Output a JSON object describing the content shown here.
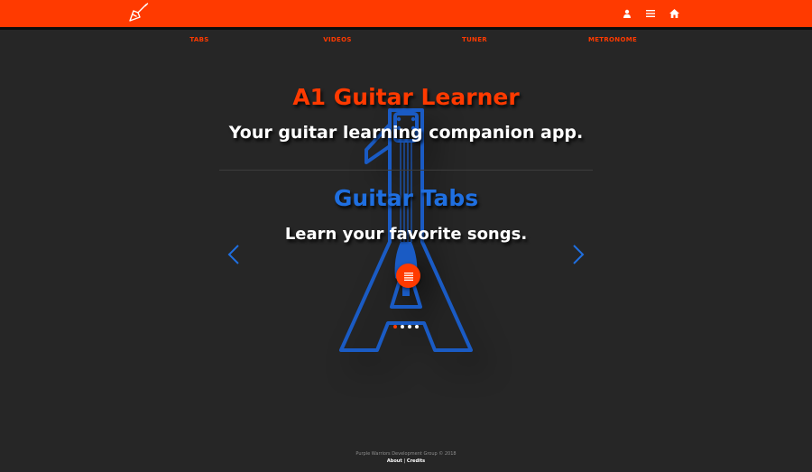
{
  "header": {
    "logo_icon": "guitar-logo-icon",
    "icons": [
      "user-icon",
      "menu-icon",
      "home-icon"
    ],
    "background": "#ff3a00"
  },
  "nav": {
    "items": [
      {
        "label": "TABS"
      },
      {
        "label": "VIDEOS"
      },
      {
        "label": "TUNER"
      },
      {
        "label": "METRONOME"
      }
    ]
  },
  "hero": {
    "title": "A1 Guitar Learner",
    "subtitle": "Your guitar learning companion app."
  },
  "carousel": {
    "slide_title": "Guitar Tabs",
    "slide_subtitle": "Learn your favorite songs.",
    "prev_icon": "chevron-left-icon",
    "next_icon": "chevron-right-icon",
    "action_icon": "list-icon",
    "slide_count": 4,
    "active_index": 0
  },
  "footer": {
    "copyright": "Purple Warriors Development Group © 2018",
    "about": "About",
    "separator": "|",
    "credits": "Credits"
  },
  "colors": {
    "accent": "#ff3a00",
    "brand_blue": "#1f6fe0",
    "background": "#262626"
  }
}
